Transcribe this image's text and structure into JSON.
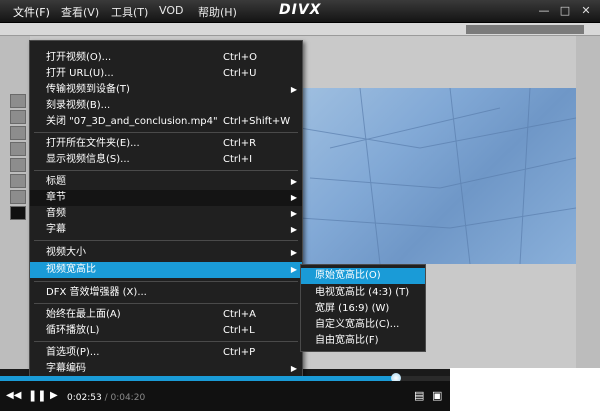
{
  "menubar": {
    "items": [
      "文件(F)",
      "查看(V)",
      "工具(T)",
      "VOD",
      "帮助(H)"
    ],
    "logo": "DIVX"
  },
  "menu": {
    "items": [
      {
        "label": "打开视频(O)...",
        "shortcut": "Ctrl+O"
      },
      {
        "label": "打开 URL(U)...",
        "shortcut": "Ctrl+U"
      },
      {
        "label": "传输视频到设备(T)",
        "shortcut": ""
      },
      {
        "label": "刻录视频(B)...",
        "shortcut": ""
      },
      {
        "label": "关闭 \"07_3D_and_conclusion.mp4\"",
        "shortcut": "Ctrl+Shift+W"
      },
      {
        "label": "打开所在文件夹(E)...",
        "shortcut": "Ctrl+R"
      },
      {
        "label": "显示视频信息(S)...",
        "shortcut": "Ctrl+I"
      },
      {
        "label": "标题",
        "shortcut": ""
      },
      {
        "label": "章节",
        "shortcut": ""
      },
      {
        "label": "音频",
        "shortcut": ""
      },
      {
        "label": "字幕",
        "shortcut": ""
      },
      {
        "label": "视频大小",
        "shortcut": ""
      },
      {
        "label": "视频宽高比",
        "shortcut": ""
      },
      {
        "label": "DFX 音效增强器 (X)...",
        "shortcut": ""
      },
      {
        "label": "始终在最上面(A)",
        "shortcut": "Ctrl+A"
      },
      {
        "label": "循环播放(L)",
        "shortcut": "Ctrl+L"
      },
      {
        "label": "首选项(P)...",
        "shortcut": "Ctrl+P"
      },
      {
        "label": "字幕编码",
        "shortcut": ""
      }
    ]
  },
  "submenu": {
    "items": [
      "原始宽高比(O)",
      "电视宽高比 (4:3) (T)",
      "宽屏 (16:9) (W)",
      "自定义宽高比(C)...",
      "自由宽高比(F)"
    ]
  },
  "player": {
    "current_time": "0:02:53",
    "total_time": "/ 0:04:20",
    "progress": 0.88
  },
  "colors": {
    "highlight": "#1a9bd7"
  }
}
